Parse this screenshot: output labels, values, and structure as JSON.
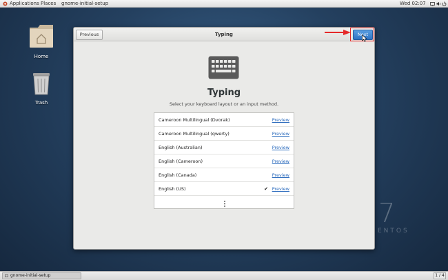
{
  "top_panel": {
    "applications": "Applications",
    "places": "Places",
    "app_name": "gnome-initial-setup",
    "clock": "Wed 02:07"
  },
  "desktop": {
    "home_label": "Home",
    "trash_label": "Trash",
    "watermark_number": "7",
    "watermark_text": "ENTOS"
  },
  "dialog": {
    "previous_label": "Previous",
    "title": "Typing",
    "next_label": "Next",
    "heading": "Typing",
    "subtitle": "Select your keyboard layout or an input method.",
    "layouts": [
      {
        "name": "Cameroon Multilingual (Dvorak)",
        "action": "Preview",
        "selected": false
      },
      {
        "name": "Cameroon Multilingual (qwerty)",
        "action": "Preview",
        "selected": false
      },
      {
        "name": "English (Australian)",
        "action": "Preview",
        "selected": false
      },
      {
        "name": "English (Cameroon)",
        "action": "Preview",
        "selected": false
      },
      {
        "name": "English (Canada)",
        "action": "Preview",
        "selected": false
      },
      {
        "name": "English (US)",
        "action": "Preview",
        "selected": true,
        "check": "✔"
      }
    ]
  },
  "taskbar": {
    "task_label": "gnome-initial-setup",
    "workspace": "1 / 4"
  },
  "icons": {
    "applications": "applications-icon",
    "network": "network-icon",
    "volume": "volume-icon",
    "power": "power-icon",
    "home": "home-folder-icon",
    "trash": "trash-icon",
    "keyboard": "keyboard-icon",
    "more": "more-vertical-icon"
  },
  "colors": {
    "accent": "#2f74c5",
    "highlight": "#e52929"
  }
}
